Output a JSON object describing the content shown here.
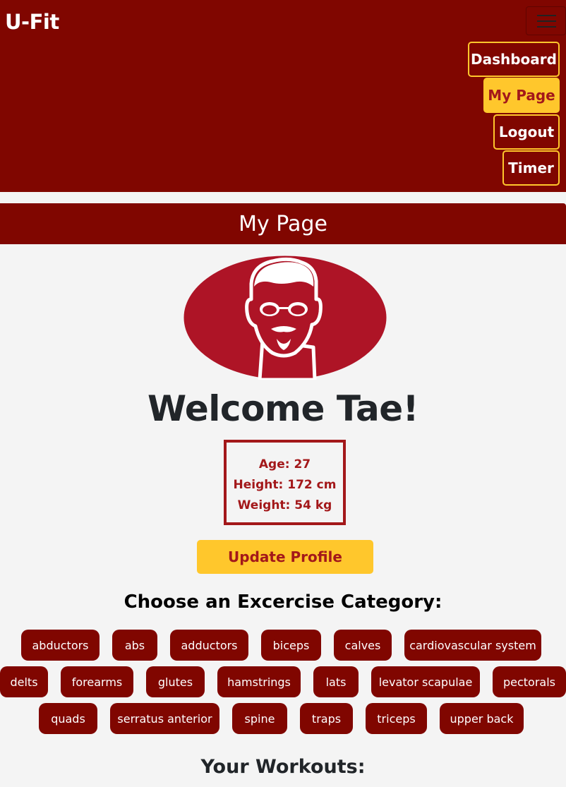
{
  "navbar": {
    "brand": "U-Fit",
    "links": [
      "Dashboard",
      "My Page",
      "Logout",
      "Timer"
    ],
    "active": "My Page"
  },
  "page": {
    "header": "My Page",
    "welcome": "Welcome Tae!",
    "stats": {
      "age": "Age: 27",
      "height": "Height: 172 cm",
      "weight": "Weight: 54 kg"
    },
    "update_button": "Update Profile"
  },
  "categories": {
    "title": "Choose an Excercise Category:",
    "rows": [
      [
        "abductors",
        "abs",
        "adductors",
        "biceps",
        "calves",
        "cardiovascular system"
      ],
      [
        "delts",
        "forearms",
        "glutes",
        "hamstrings",
        "lats",
        "levator scapulae",
        "pectorals"
      ],
      [
        "quads",
        "serratus anterior",
        "spine",
        "traps",
        "triceps",
        "upper back"
      ]
    ]
  },
  "workouts": {
    "title": "Your Workouts:"
  },
  "colors": {
    "primary": "#800600",
    "accent": "#ffc72c",
    "text_red": "#a3181a",
    "avatar_bg": "#ae1426"
  }
}
